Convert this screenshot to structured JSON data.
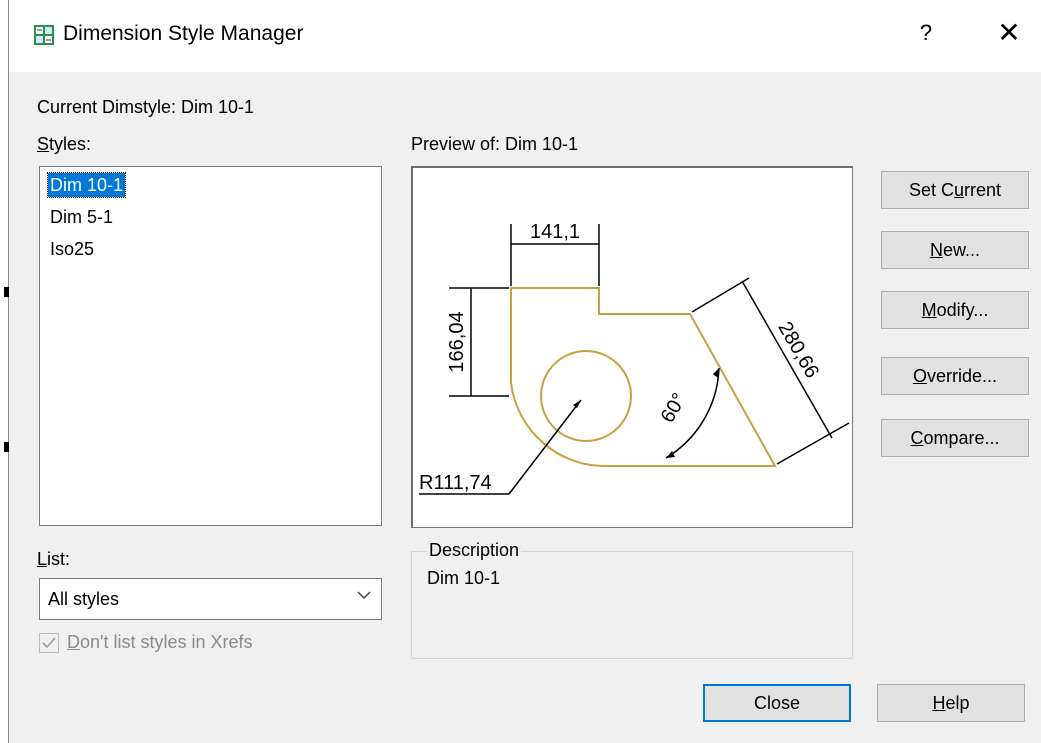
{
  "window": {
    "title": "Dimension Style Manager",
    "help": "?",
    "close": "✕"
  },
  "current_dimstyle": "Current Dimstyle: Dim 10-1",
  "styles": {
    "label_u": "S",
    "label_rest": "tyles:",
    "items": [
      "Dim 10-1",
      "Dim 5-1",
      "Iso25"
    ],
    "selected": "Dim 10-1"
  },
  "preview": {
    "label": "Preview of: Dim 10-1",
    "dims": {
      "top": "141,1",
      "left": "166,04",
      "diag": "280,66",
      "angle": "60°",
      "radius": "R111,74"
    },
    "line_color": "#c8a040"
  },
  "list": {
    "label_u": "L",
    "label_rest": "ist:",
    "selected": "All styles",
    "checkbox_pre": "",
    "checkbox_u": "D",
    "checkbox_rest": "on't list styles in Xrefs",
    "checkbox_checked": true
  },
  "description": {
    "legend": "Description",
    "text": "Dim 10-1"
  },
  "buttons": {
    "set_current_pre": "Set C",
    "set_current_u": "u",
    "set_current_post": "rrent",
    "new_u": "N",
    "new_post": "ew...",
    "modify_u": "M",
    "modify_post": "odify...",
    "override_u": "O",
    "override_post": "verride...",
    "compare_u": "C",
    "compare_post": "ompare...",
    "close": "Close",
    "help_u": "H",
    "help_post": "elp"
  },
  "colors": {
    "accent": "#0078d7",
    "dialog_bg": "#f0f0f0"
  }
}
